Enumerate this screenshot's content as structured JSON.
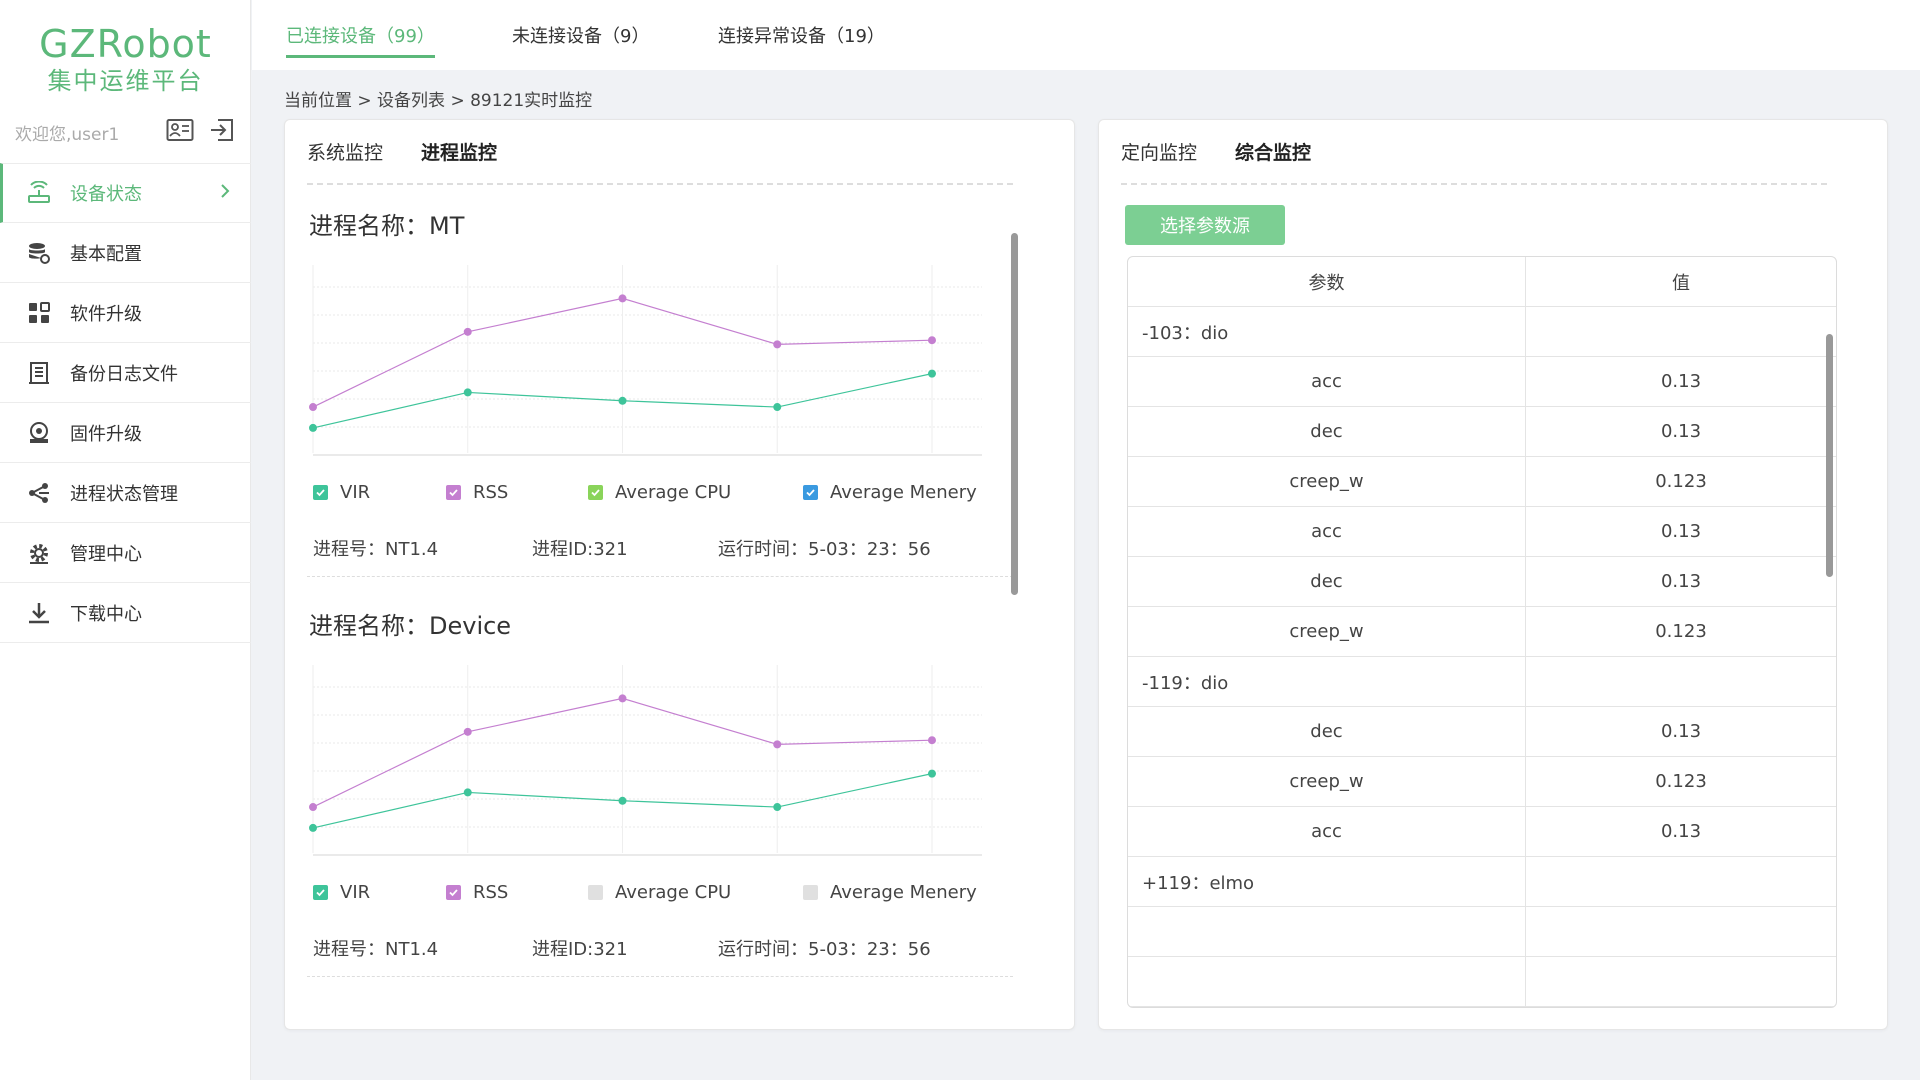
{
  "sidebar": {
    "logo_main": "GZRobot",
    "logo_sub": "集中运维平台",
    "welcome": "欢迎您,user1",
    "items": [
      {
        "label": "设备状态",
        "icon": "router-icon",
        "active": true
      },
      {
        "label": "基本配置",
        "icon": "database-gear-icon"
      },
      {
        "label": "软件升级",
        "icon": "grid-icon"
      },
      {
        "label": "备份日志文件",
        "icon": "document-icon"
      },
      {
        "label": "固件升级",
        "icon": "firmware-icon"
      },
      {
        "label": "进程状态管理",
        "icon": "share-icon"
      },
      {
        "label": "管理中心",
        "icon": "gear-icon"
      },
      {
        "label": "下载中心",
        "icon": "download-icon"
      }
    ]
  },
  "topbar": {
    "tabs": [
      {
        "label": "已连接设备（99）",
        "active": true
      },
      {
        "label": "未连接设备（9）"
      },
      {
        "label": "连接异常设备（19）"
      }
    ]
  },
  "breadcrumb": "当前位置 > 设备列表 > 89121实时监控",
  "left_panel": {
    "tabs": [
      {
        "label": "系统监控"
      },
      {
        "label": "进程监控",
        "active": true
      }
    ],
    "processes": [
      {
        "title": "进程名称：MT",
        "legend": [
          {
            "label": "VIR",
            "checked": true,
            "color": "#3ec49a"
          },
          {
            "label": "RSS",
            "checked": true,
            "color": "#c47fd0"
          },
          {
            "label": "Average CPU",
            "checked": true,
            "color": "#8ad45a"
          },
          {
            "label": "Average Menery",
            "checked": true,
            "color": "#3a9ae0"
          }
        ],
        "pid_label": "进程号：NT1.4",
        "id_label": "进程ID:321",
        "runtime_label": "运行时间：5-03：23：56"
      },
      {
        "title": "进程名称：Device",
        "legend": [
          {
            "label": "VIR",
            "checked": true,
            "color": "#3ec49a"
          },
          {
            "label": "RSS",
            "checked": true,
            "color": "#c47fd0"
          },
          {
            "label": "Average CPU",
            "checked": false,
            "color": "#dcdcdc"
          },
          {
            "label": "Average Menery",
            "checked": false,
            "color": "#dcdcdc"
          }
        ],
        "pid_label": "进程号：NT1.4",
        "id_label": "进程ID:321",
        "runtime_label": "运行时间：5-03：23：56"
      }
    ]
  },
  "chart_data": [
    {
      "type": "line",
      "x": [
        1,
        2,
        3,
        4,
        5
      ],
      "ylim": [
        0,
        9
      ],
      "grid": true,
      "series": [
        {
          "name": "RSS",
          "color": "#c47fd0",
          "values": [
            2.2,
            5.8,
            7.4,
            5.2,
            5.4
          ]
        },
        {
          "name": "VIR",
          "color": "#3ec49a",
          "values": [
            1.2,
            2.9,
            2.5,
            2.2,
            3.8
          ]
        }
      ]
    },
    {
      "type": "line",
      "x": [
        1,
        2,
        3,
        4,
        5
      ],
      "ylim": [
        0,
        9
      ],
      "grid": true,
      "series": [
        {
          "name": "RSS",
          "color": "#c47fd0",
          "values": [
            2.2,
            5.8,
            7.4,
            5.2,
            5.4
          ]
        },
        {
          "name": "VIR",
          "color": "#3ec49a",
          "values": [
            1.2,
            2.9,
            2.5,
            2.2,
            3.8
          ]
        }
      ]
    }
  ],
  "right_panel": {
    "tabs": [
      {
        "label": "定向监控"
      },
      {
        "label": "综合监控",
        "active": true
      }
    ],
    "button_label": "选择参数源",
    "table": {
      "headers": [
        "参数",
        "值"
      ],
      "rows": [
        {
          "param": "-103：dio",
          "value": "",
          "group": true
        },
        {
          "param": "acc",
          "value": "0.13"
        },
        {
          "param": "dec",
          "value": "0.13"
        },
        {
          "param": "creep_w",
          "value": "0.123"
        },
        {
          "param": "acc",
          "value": "0.13"
        },
        {
          "param": "dec",
          "value": "0.13"
        },
        {
          "param": "creep_w",
          "value": "0.123"
        },
        {
          "param": "-119：dio",
          "value": "",
          "group": true
        },
        {
          "param": "dec",
          "value": "0.13"
        },
        {
          "param": "creep_w",
          "value": "0.123"
        },
        {
          "param": "acc",
          "value": "0.13"
        },
        {
          "param": "+119：elmo",
          "value": "",
          "group": true
        },
        {
          "param": "",
          "value": ""
        },
        {
          "param": "",
          "value": ""
        }
      ]
    }
  },
  "colors": {
    "accent": "#5cb87a",
    "button": "#7ccf93"
  }
}
